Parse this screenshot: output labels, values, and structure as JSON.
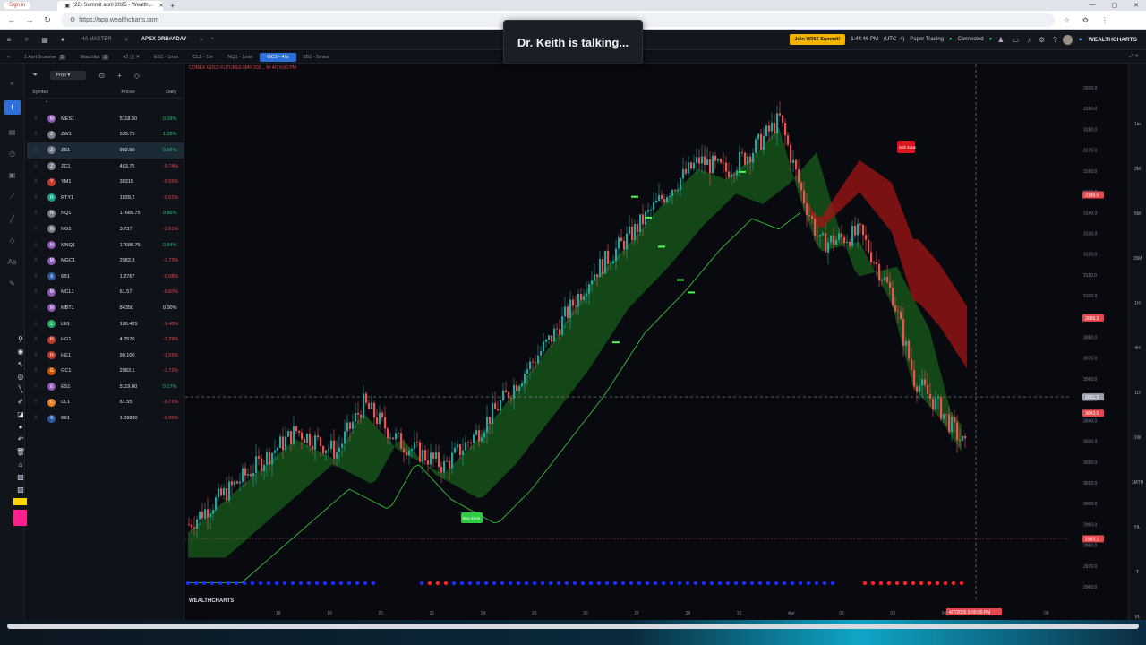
{
  "browser": {
    "signin": "Sign in",
    "tab_title": "(22) Summit april 2025 - Wealth...",
    "url": "https://app.wealthcharts.com"
  },
  "header": {
    "tabs": [
      "HA MASTER",
      "APEX DRB#ADAY"
    ],
    "summit_button": "Join W365 Summit!",
    "time": "1:44:46 PM",
    "timezone": "(UTC -4)",
    "paper_trading": "Paper Trading",
    "connected": "Connected",
    "brand": "WEALTHCHARTS"
  },
  "toast": "Dr. Keith is talking...",
  "subtabs": [
    {
      "label": "1 Asrt Scanner",
      "active": false
    },
    {
      "label": "Watchlist",
      "active": false
    },
    {
      "label": "ES1 - 1min",
      "active": false
    },
    {
      "label": "CL1 - 1hr",
      "active": false
    },
    {
      "label": "NQ1 - 1min",
      "active": false
    },
    {
      "label": "GC1 - 4hr",
      "active": true
    },
    {
      "label": "6B1 - 5mins",
      "active": false
    }
  ],
  "watchlist": {
    "dropdown": "Prop",
    "col_symbol": "Symbol",
    "col_prices": "Prices",
    "col_daily": "Daily",
    "rows": [
      {
        "sym": "MES1",
        "badge": "M",
        "price": "5118.50",
        "chg": "0.18%",
        "dir": "pos"
      },
      {
        "sym": "ZW1",
        "badge": "Z",
        "price": "535.75",
        "chg": "1.28%",
        "dir": "pos"
      },
      {
        "sym": "ZS1",
        "badge": "Z",
        "price": "982.50",
        "chg": "0.56%",
        "dir": "pos"
      },
      {
        "sym": "ZC1",
        "badge": "Z",
        "price": "463.75",
        "chg": "-0.74%",
        "dir": "neg"
      },
      {
        "sym": "YM1",
        "badge": "Y",
        "price": "38315",
        "chg": "-0.55%",
        "dir": "neg"
      },
      {
        "sym": "RTY1",
        "badge": "R",
        "price": "1839.2",
        "chg": "-0.01%",
        "dir": "neg"
      },
      {
        "sym": "NQ1",
        "badge": "N",
        "price": "17689.75",
        "chg": "0.86%",
        "dir": "pos"
      },
      {
        "sym": "NG1",
        "badge": "N",
        "price": "3.737",
        "chg": "-2.61%",
        "dir": "neg"
      },
      {
        "sym": "MNQ1",
        "badge": "M",
        "price": "17686.75",
        "chg": "0.84%",
        "dir": "pos"
      },
      {
        "sym": "MGC1",
        "badge": "M",
        "price": "2982.8",
        "chg": "-1.73%",
        "dir": "neg"
      },
      {
        "sym": "6B1",
        "badge": "6",
        "price": "1.2767",
        "chg": "-0.08%",
        "dir": "neg"
      },
      {
        "sym": "MCL1",
        "badge": "M",
        "price": "61.57",
        "chg": "-0.60%",
        "dir": "neg"
      },
      {
        "sym": "MBT1",
        "badge": "M",
        "price": "84350",
        "chg": "0.00%",
        "dir": "flat"
      },
      {
        "sym": "LE1",
        "badge": "L",
        "price": "195.425",
        "chg": "-1.40%",
        "dir": "neg"
      },
      {
        "sym": "HG1",
        "badge": "H",
        "price": "4.2570",
        "chg": "-3.29%",
        "dir": "neg"
      },
      {
        "sym": "HE1",
        "badge": "H",
        "price": "90.100",
        "chg": "-1.55%",
        "dir": "neg"
      },
      {
        "sym": "GC1",
        "badge": "G",
        "price": "2983.1",
        "chg": "-1.72%",
        "dir": "neg"
      },
      {
        "sym": "ES1",
        "badge": "E",
        "price": "5119.00",
        "chg": "0.17%",
        "dir": "pos"
      },
      {
        "sym": "CL1",
        "badge": "C",
        "price": "61.55",
        "chg": "-0.71%",
        "dir": "neg"
      },
      {
        "sym": "6E1",
        "badge": "6",
        "price": "1.09830",
        "chg": "-0.05%",
        "dir": "neg"
      }
    ]
  },
  "chart": {
    "title": "COMEX GOLD FUTURES MAY 202... 4h 4/7 6:00 PM",
    "watermark": "WEALTHCHARTS",
    "sell_label": "Sell Zone",
    "buy_label": "Buy Zone",
    "cursor_date": "4/7/2025 6:00:00 PM",
    "price_axis": [
      "3200.0",
      "3190.0",
      "3180.0",
      "3170.0",
      "3160.0",
      "3150.0",
      "3140.0",
      "3130.0",
      "3120.0",
      "3110.0",
      "3100.0",
      "3090.0",
      "3080.0",
      "3070.0",
      "3060.0",
      "3050.0",
      "3040.0",
      "3030.0",
      "3020.0",
      "3010.0",
      "3000.0",
      "2990.0",
      "2980.0",
      "2970.0",
      "2960.0"
    ],
    "date_axis": [
      "18",
      "19",
      "20",
      "21",
      "24",
      "25",
      "26",
      "27",
      "28",
      "31",
      "Apr",
      "02",
      "03",
      "04",
      "07",
      "08"
    ],
    "tags": [
      {
        "label": "3148.5",
        "price": 3148.5,
        "color": "#e8474d"
      },
      {
        "label": "3089.3",
        "price": 3089.3,
        "color": "#e8474d"
      },
      {
        "label": "3051.3",
        "price": 3051.3,
        "color": "#9aa0ad"
      },
      {
        "label": "3043.5",
        "price": 3043.5,
        "color": "#e8474d"
      },
      {
        "label": "2983.1",
        "price": 2983.1,
        "color": "#e8474d"
      }
    ],
    "right_labels": [
      "1m",
      "3M",
      "5M",
      "15M",
      "1H",
      "4H",
      "1D",
      "1W",
      "1MTH",
      "HL",
      "T",
      "VL"
    ]
  },
  "colors": {
    "up": "#26a69a",
    "down": "#ef5350",
    "accent": "#2e6fd8"
  }
}
